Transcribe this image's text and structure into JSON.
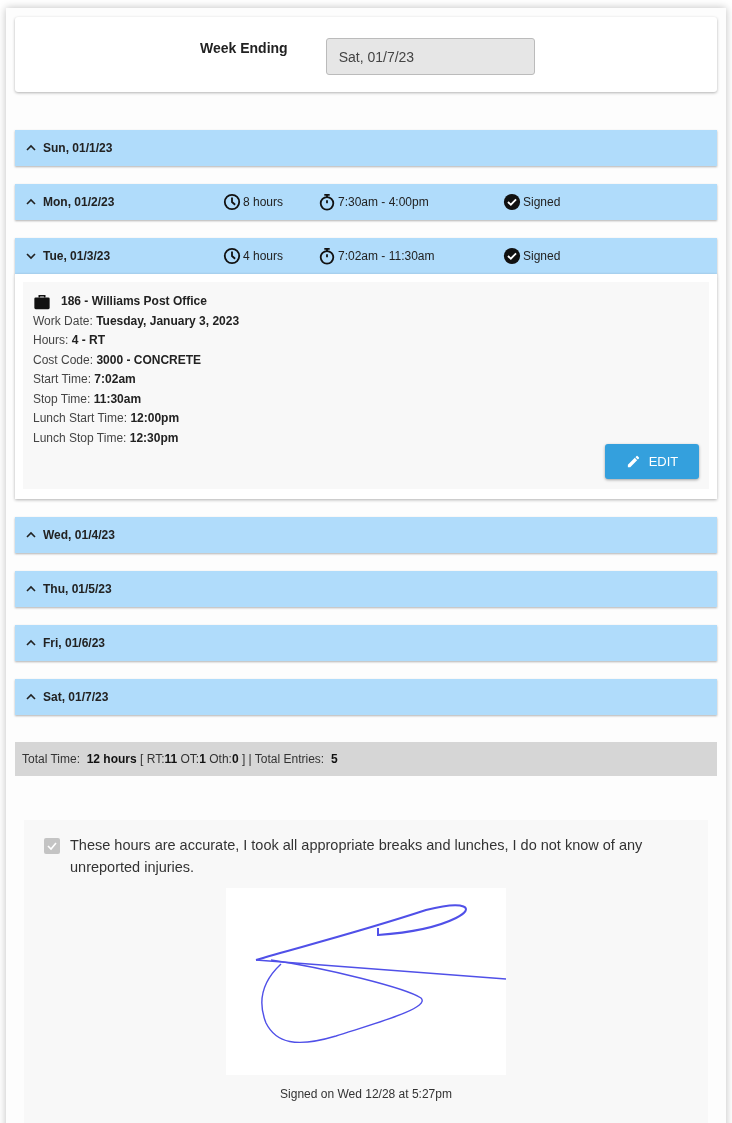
{
  "week_ending": {
    "label": "Week Ending",
    "value": "Sat, 01/7/23"
  },
  "days": [
    {
      "label": "Sun, 01/1/23",
      "expanded": false
    },
    {
      "label": "Mon, 01/2/23",
      "expanded": false,
      "hours": "8 hours",
      "time_range": "7:30am - 4:00pm",
      "status": "Signed"
    },
    {
      "label": "Tue, 01/3/23",
      "expanded": true,
      "hours": "4 hours",
      "time_range": "7:02am - 11:30am",
      "status": "Signed",
      "entry": {
        "job": "186 - Williams Post Office",
        "fields": [
          "Work Date: **Tuesday, January 3, 2023**",
          "Hours: **4 - RT**",
          "Cost Code: **3000 - CONCRETE**",
          "Start Time: **7:02am**",
          "Stop Time: **11:30am**",
          "Lunch Start Time: **12:00pm**",
          "Lunch Stop Time: **12:30pm**"
        ],
        "button": "EDIT"
      }
    },
    {
      "label": "Wed, 01/4/23",
      "expanded": false
    },
    {
      "label": "Thu, 01/5/23",
      "expanded": false
    },
    {
      "label": "Fri, 01/6/23",
      "expanded": false
    },
    {
      "label": "Sat, 01/7/23",
      "expanded": false
    }
  ],
  "totals": "Total Time:  **12 hours** [ RT:**11** OT:**1** Oth:**0** ] | Total Entries:  **5**",
  "attestation": {
    "checked": true,
    "disabled": true,
    "text": "These hours are accurate, I took all appropriate breaks and lunches, I do not know of any unreported injuries.",
    "signed_on": "Signed on Wed 12/28 at 5:27pm"
  }
}
